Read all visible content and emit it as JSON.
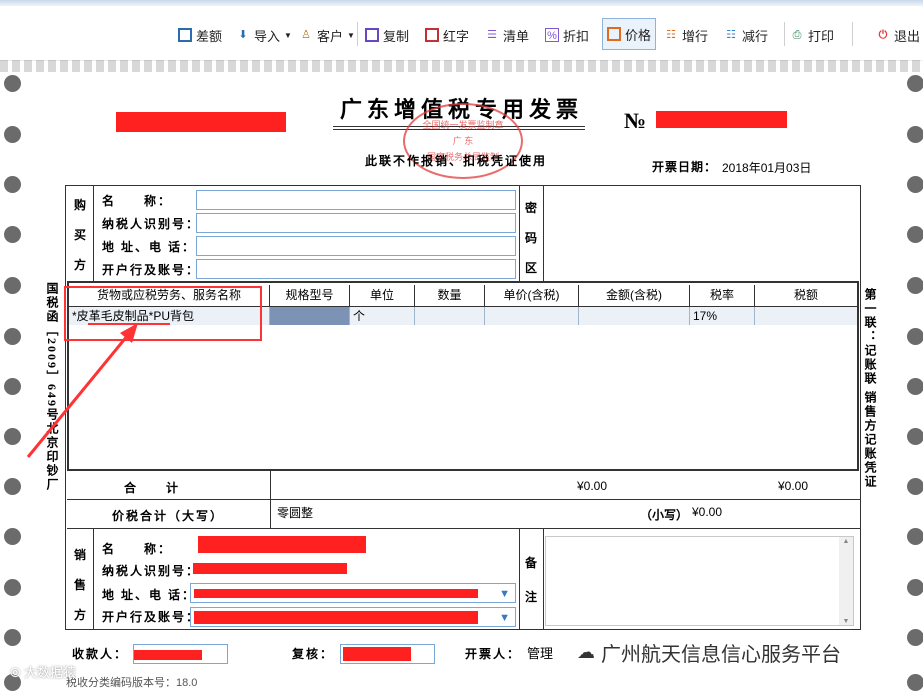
{
  "toolbar": {
    "buttons": [
      {
        "label": "差额",
        "icon": "table-icon",
        "color": "#2b6cb0"
      },
      {
        "label": "导入",
        "icon": "import-icon",
        "color": "#2b6cb0",
        "dropdown": true
      },
      {
        "label": "客户",
        "icon": "customer-icon",
        "color": "#b7791f",
        "dropdown": true
      },
      {
        "label": "复制",
        "icon": "copy-icon",
        "color": "#6b46c1"
      },
      {
        "label": "红字",
        "icon": "red-invoice-icon",
        "color": "#c53030"
      },
      {
        "label": "清单",
        "icon": "list-icon",
        "color": "#805ad5"
      },
      {
        "label": "折扣",
        "icon": "discount-icon",
        "color": "#805ad5"
      },
      {
        "label": "价格",
        "icon": "price-icon",
        "color": "#dd6b20",
        "active": true
      },
      {
        "label": "增行",
        "icon": "add-row-icon",
        "color": "#dd6b20"
      },
      {
        "label": "减行",
        "icon": "remove-row-icon",
        "color": "#3182ce"
      },
      {
        "label": "打印",
        "icon": "print-icon",
        "color": "#2f855a"
      },
      {
        "label": "退出",
        "icon": "power-icon",
        "color": "#e53e3e"
      }
    ]
  },
  "invoice": {
    "title": "广东增值税专用发票",
    "no_label": "№",
    "subtitle": "此联不作报销、扣税凭证使用",
    "date_label": "开票日期：",
    "date_value": "2018年01月03日",
    "stamp_lines": [
      "全国统一发票监制章",
      "国家税务总局监制",
      "广  东"
    ],
    "left_vertical": "国税函［2009］649号北京印钞厂",
    "right_vertical": "第一联：记账联 销售方记账凭证",
    "buyer": {
      "section_label": [
        "购",
        "买",
        "方"
      ],
      "fields": [
        "名　　称：",
        "纳税人识别号：",
        "地 址、电 话：",
        "开户行及账号："
      ],
      "values": [
        "",
        "",
        "",
        ""
      ]
    },
    "password_label": [
      "密",
      "码",
      "区"
    ],
    "table": {
      "headers": [
        "货物或应税劳务、服务名称",
        "规格型号",
        "单位",
        "数量",
        "单价(含税)",
        "金额(含税)",
        "税率",
        "税额"
      ],
      "row": [
        "*皮革毛皮制品*PU背包",
        "",
        "个",
        "",
        "",
        "",
        "17%",
        ""
      ],
      "total_label": "合　　计",
      "total_amount": "¥0.00",
      "total_tax": "¥0.00"
    },
    "price_tax_total": {
      "label": "价税合计（大写）",
      "upper": "零圆整",
      "lower_label": "（小写）",
      "lower": "¥0.00"
    },
    "seller": {
      "section_label": [
        "销",
        "售",
        "方"
      ],
      "fields": [
        "名　　称：",
        "纳税人识别号：",
        "地 址、电 话：",
        "开户行及账号："
      ]
    },
    "remark_label": [
      "备",
      "注"
    ],
    "footer": {
      "payee_label": "收款人：",
      "reviewer_label": "复核：",
      "drawer_label": "开票人：",
      "drawer_value": "管理",
      "version": "税收分类编码版本号：18.0"
    }
  },
  "watermark": {
    "left": "大数据猿",
    "right": "广州航天信息信心服务平台"
  },
  "colors": {
    "highlight": "#ff2020",
    "input_border": "#7aa7d6",
    "row_bg": "#ecf1f7"
  }
}
